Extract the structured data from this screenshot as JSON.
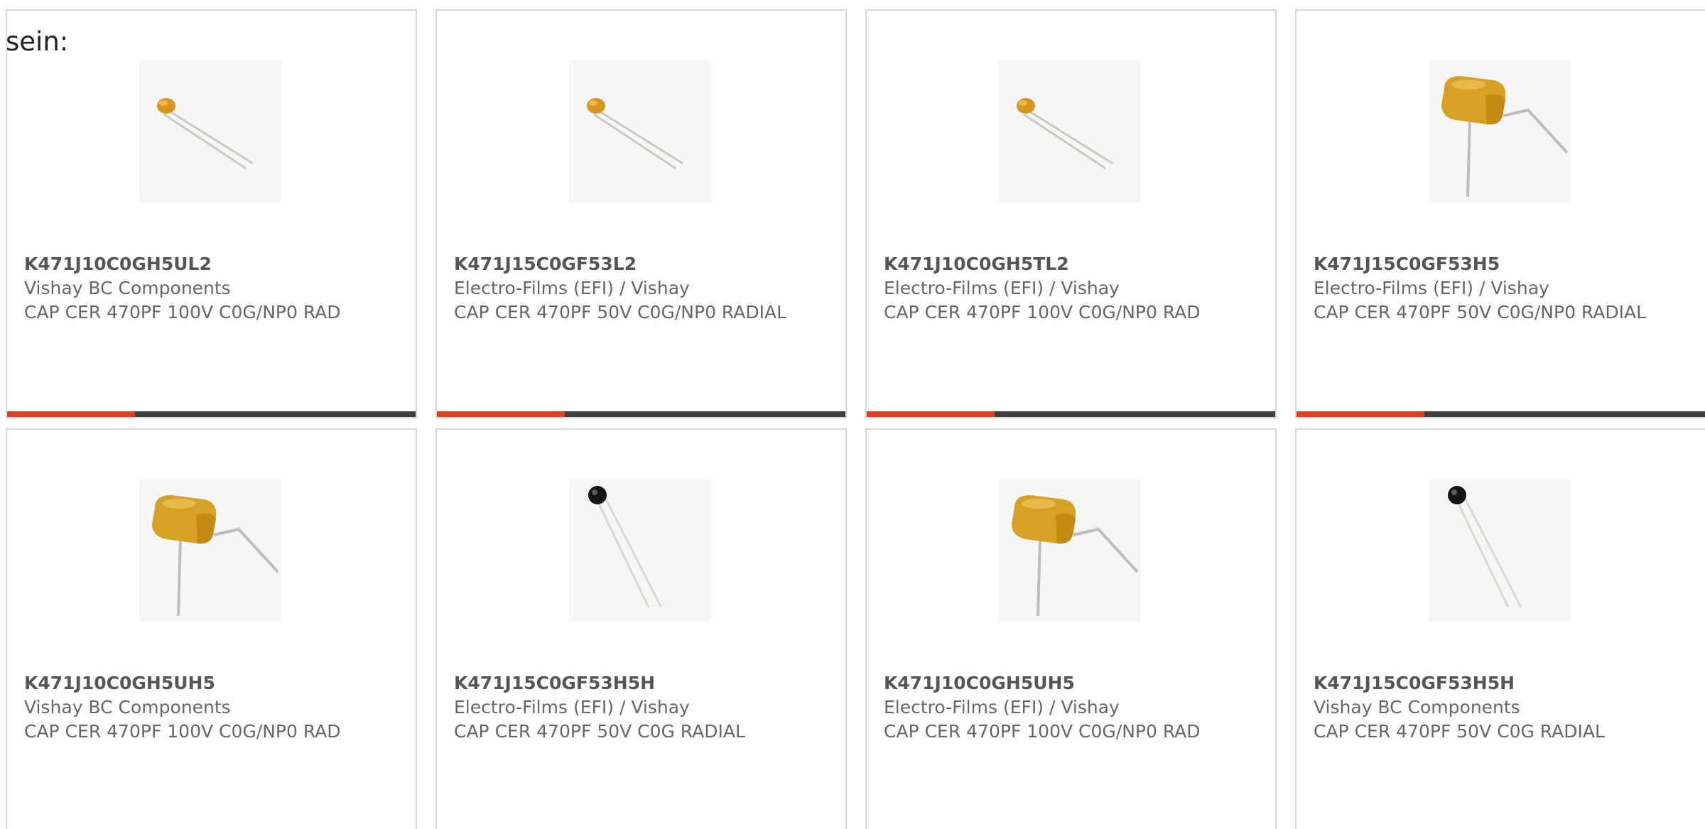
{
  "intro": "sein:",
  "accent_color": "#e2401c",
  "bar_color": "#3f3f3f",
  "products": [
    {
      "part": "K471J10C0GH5UL2",
      "manufacturer": "Vishay BC Components",
      "description": "CAP CER 470PF 100V C0G/NP0 RAD",
      "image": "small-orange-disc-capacitor"
    },
    {
      "part": "K471J15C0GF53L2",
      "manufacturer": "Electro-Films (EFI) / Vishay",
      "description": "CAP CER 470PF 50V C0G/NP0 RADIAL",
      "image": "small-orange-disc-capacitor"
    },
    {
      "part": "K471J10C0GH5TL2",
      "manufacturer": "Electro-Films (EFI) / Vishay",
      "description": "CAP CER 470PF 100V C0G/NP0 RAD",
      "image": "small-orange-disc-capacitor"
    },
    {
      "part": "K471J15C0GF53H5",
      "manufacturer": "Electro-Films (EFI) / Vishay",
      "description": "CAP CER 470PF 50V C0G/NP0 RADIAL",
      "image": "yellow-box-capacitor"
    },
    {
      "part": "K471J10C0GH5UH5",
      "manufacturer": "Vishay BC Components",
      "description": "CAP CER 470PF 100V C0G/NP0 RAD",
      "image": "yellow-box-capacitor"
    },
    {
      "part": "K471J15C0GF53H5H",
      "manufacturer": "Electro-Films (EFI) / Vishay",
      "description": "CAP CER 470PF 50V C0G RADIAL",
      "image": "black-bead-capacitor"
    },
    {
      "part": "K471J10C0GH5UH5",
      "manufacturer": "Electro-Films (EFI) / Vishay",
      "description": "CAP CER 470PF 100V C0G/NP0 RAD",
      "image": "yellow-box-capacitor"
    },
    {
      "part": "K471J15C0GF53H5H",
      "manufacturer": "Vishay BC Components",
      "description": "CAP CER 470PF 50V C0G RADIAL",
      "image": "black-bead-capacitor"
    }
  ]
}
